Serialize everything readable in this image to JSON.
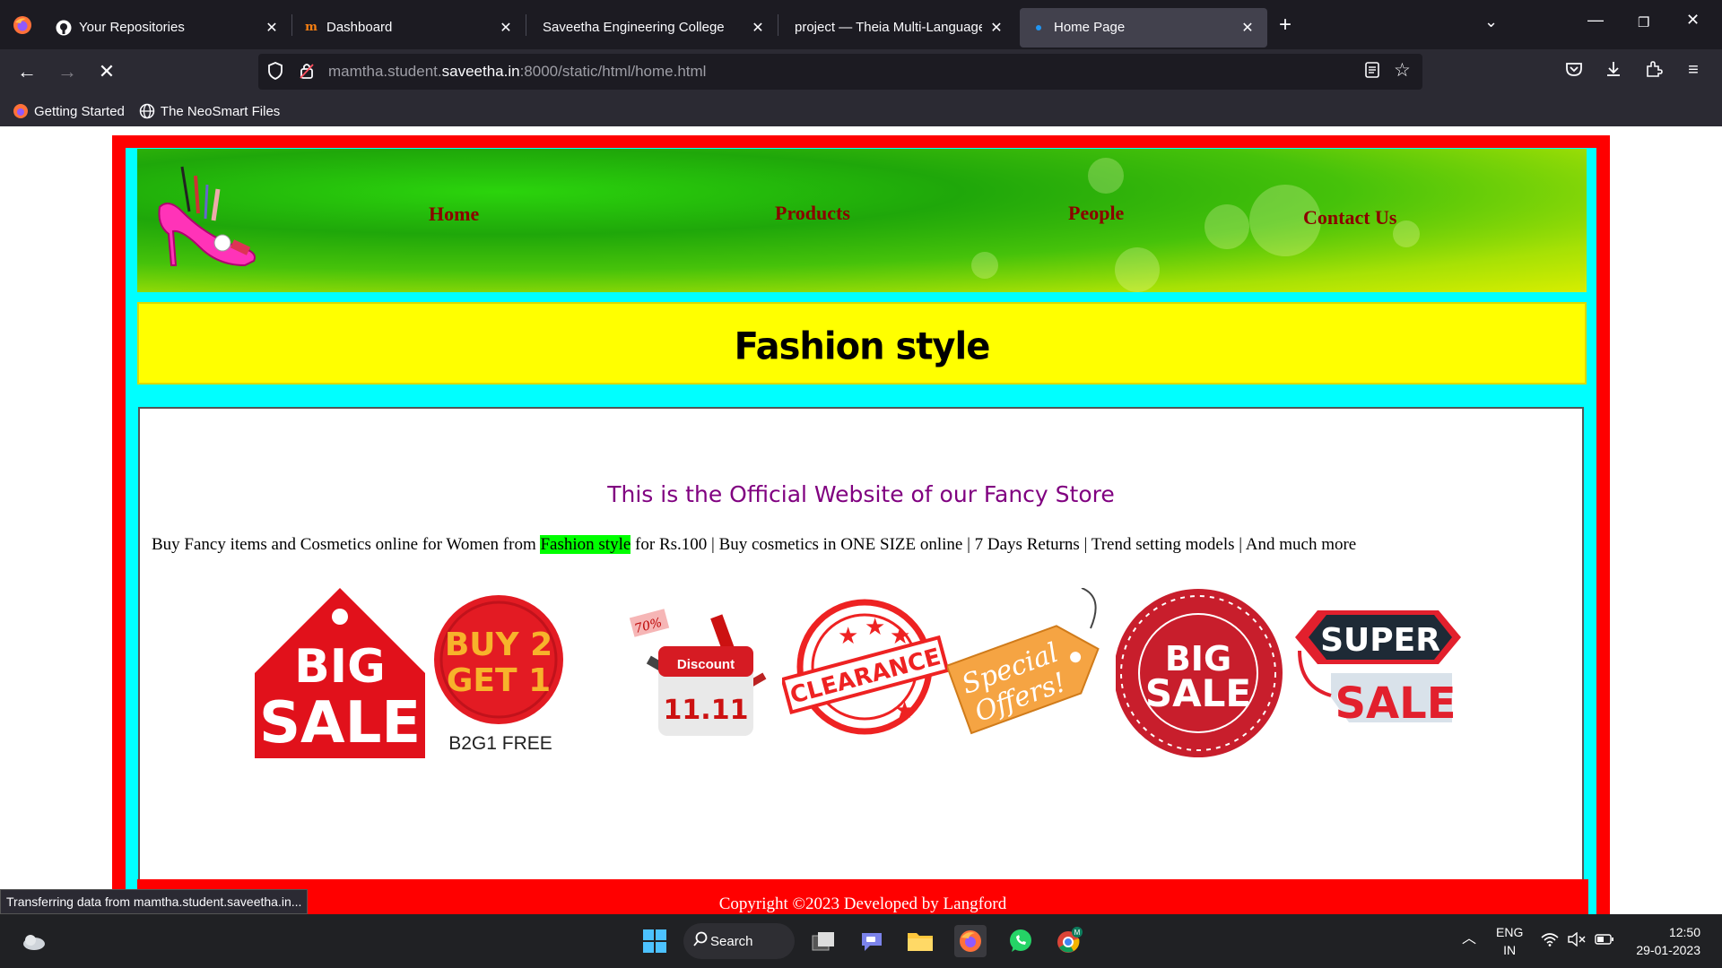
{
  "browser": {
    "tabs": [
      {
        "title": "Your Repositories",
        "icon": "github-icon",
        "active": false
      },
      {
        "title": "Dashboard",
        "icon": "moodle-icon",
        "active": false
      },
      {
        "title": "Saveetha Engineering College",
        "icon": "none",
        "active": false
      },
      {
        "title": "project — Theia Multi-Language Ex",
        "icon": "none",
        "active": false
      },
      {
        "title": "Home Page",
        "icon": "loading-dot",
        "active": true
      }
    ],
    "url_prefix": "mamtha.student.",
    "url_domain": "saveetha.in",
    "url_suffix": ":8000/static/html/home.html",
    "bookmarks": [
      {
        "label": "Getting Started",
        "icon": "firefox-icon"
      },
      {
        "label": "The NeoSmart Files",
        "icon": "globe-icon"
      }
    ],
    "status_text": "Transferring data from mamtha.student.saveetha.in..."
  },
  "site": {
    "nav": [
      "Home",
      "Products",
      "People",
      "Contact Us"
    ],
    "title": "Fashion style",
    "tagline": "This is the Official Website of our Fancy Store",
    "desc_before": "Buy Fancy items and Cosmetics online for Women from ",
    "desc_highlight": "Fashion style",
    "desc_after": " for Rs.100 | Buy cosmetics in ONE SIZE online | 7 Days Returns | Trend setting models | And much more",
    "badges": {
      "big_sale_1": [
        "BIG",
        "SALE"
      ],
      "buy2": [
        "BUY 2",
        "GET 1",
        "B2G1 FREE"
      ],
      "discount": [
        "Discount",
        "11.11",
        "70%"
      ],
      "clearance": "CLEARANCE",
      "special": [
        "Special",
        "Offers!"
      ],
      "big_sale_2": [
        "BIG",
        "SALE"
      ],
      "super_sale": [
        "SUPER",
        "SALE"
      ]
    },
    "footer": "Copyright ©2023 Developed by Langford"
  },
  "taskbar": {
    "search_label": "Search",
    "lang_1": "ENG",
    "lang_2": "IN",
    "time": "12:50",
    "date": "29-01-2023"
  },
  "colors": {
    "outer_border": "#ff0000",
    "inner_border": "#00ffff",
    "title_band": "#ffff00",
    "nav_link": "#8b0000",
    "tagline": "#800080",
    "highlight": "#00ff00"
  }
}
